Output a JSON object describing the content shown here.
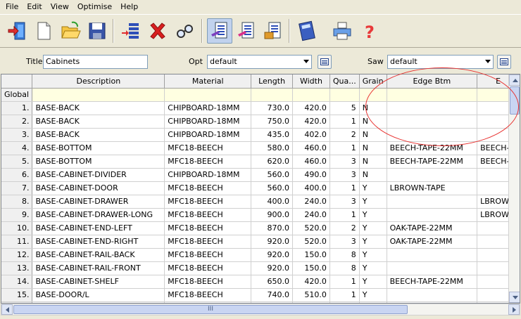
{
  "menu": [
    "File",
    "Edit",
    "View",
    "Optimise",
    "Help"
  ],
  "toolbar": {
    "buttons": [
      "exit-icon",
      "new-icon",
      "open-icon",
      "save-icon",
      "insert-row-icon",
      "delete-row-icon",
      "find-icon",
      "parts-list-icon",
      "edging-list-icon",
      "board-list-icon",
      "calculator-icon",
      "print-icon",
      "help-icon"
    ]
  },
  "params": {
    "title_label": "Title",
    "title_value": "Cabinets",
    "opt_label": "Opt",
    "opt_value": "default",
    "saw_label": "Saw",
    "saw_value": "default"
  },
  "grid": {
    "columns": [
      "",
      "Description",
      "Material",
      "Length",
      "Width",
      "Qua...",
      "Grain",
      "Edge Btm",
      "E"
    ],
    "global_label": "Global",
    "rows": [
      {
        "n": "1.",
        "desc": "BASE-BACK",
        "mat": "CHIPBOARD-18MM",
        "len": "730.0",
        "wid": "420.0",
        "qty": "5",
        "grain": "N",
        "edge": "",
        "e2": ""
      },
      {
        "n": "2.",
        "desc": "BASE-BACK",
        "mat": "CHIPBOARD-18MM",
        "len": "750.0",
        "wid": "420.0",
        "qty": "1",
        "grain": "N",
        "edge": "",
        "e2": ""
      },
      {
        "n": "3.",
        "desc": "BASE-BACK",
        "mat": "CHIPBOARD-18MM",
        "len": "435.0",
        "wid": "402.0",
        "qty": "2",
        "grain": "N",
        "edge": "",
        "e2": ""
      },
      {
        "n": "4.",
        "desc": "BASE-BOTTOM",
        "mat": "MFC18-BEECH",
        "len": "580.0",
        "wid": "460.0",
        "qty": "1",
        "grain": "N",
        "edge": "BEECH-TAPE-22MM",
        "e2": "BEECH-T"
      },
      {
        "n": "5.",
        "desc": "BASE-BOTTOM",
        "mat": "MFC18-BEECH",
        "len": "620.0",
        "wid": "460.0",
        "qty": "3",
        "grain": "N",
        "edge": "BEECH-TAPE-22MM",
        "e2": "BEECH-T"
      },
      {
        "n": "6.",
        "desc": "BASE-CABINET-DIVIDER",
        "mat": "CHIPBOARD-18MM",
        "len": "560.0",
        "wid": "490.0",
        "qty": "3",
        "grain": "N",
        "edge": "",
        "e2": ""
      },
      {
        "n": "7.",
        "desc": "BASE-CABINET-DOOR",
        "mat": "MFC18-BEECH",
        "len": "560.0",
        "wid": "400.0",
        "qty": "1",
        "grain": "Y",
        "edge": "LBROWN-TAPE",
        "e2": ""
      },
      {
        "n": "8.",
        "desc": "BASE-CABINET-DRAWER",
        "mat": "MFC18-BEECH",
        "len": "400.0",
        "wid": "240.0",
        "qty": "3",
        "grain": "Y",
        "edge": "",
        "e2": "LBROWN"
      },
      {
        "n": "9.",
        "desc": "BASE-CABINET-DRAWER-LONG",
        "mat": "MFC18-BEECH",
        "len": "900.0",
        "wid": "240.0",
        "qty": "1",
        "grain": "Y",
        "edge": "",
        "e2": "LBROWN"
      },
      {
        "n": "10.",
        "desc": "BASE-CABINET-END-LEFT",
        "mat": "MFC18-BEECH",
        "len": "870.0",
        "wid": "520.0",
        "qty": "2",
        "grain": "Y",
        "edge": "OAK-TAPE-22MM",
        "e2": ""
      },
      {
        "n": "11.",
        "desc": "BASE-CABINET-END-RIGHT",
        "mat": "MFC18-BEECH",
        "len": "920.0",
        "wid": "520.0",
        "qty": "3",
        "grain": "Y",
        "edge": "OAK-TAPE-22MM",
        "e2": ""
      },
      {
        "n": "12.",
        "desc": "BASE-CABINET-RAIL-BACK",
        "mat": "MFC18-BEECH",
        "len": "920.0",
        "wid": "150.0",
        "qty": "8",
        "grain": "Y",
        "edge": "",
        "e2": ""
      },
      {
        "n": "13.",
        "desc": "BASE-CABINET-RAIL-FRONT",
        "mat": "MFC18-BEECH",
        "len": "920.0",
        "wid": "150.0",
        "qty": "8",
        "grain": "Y",
        "edge": "",
        "e2": ""
      },
      {
        "n": "14.",
        "desc": "BASE-CABINET-SHELF",
        "mat": "MFC18-BEECH",
        "len": "650.0",
        "wid": "420.0",
        "qty": "1",
        "grain": "Y",
        "edge": "BEECH-TAPE-22MM",
        "e2": ""
      },
      {
        "n": "15.",
        "desc": "BASE-DOOR/L",
        "mat": "MFC18-BEECH",
        "len": "740.0",
        "wid": "510.0",
        "qty": "1",
        "grain": "Y",
        "edge": "",
        "e2": ""
      },
      {
        "n": "",
        "desc": "",
        "mat": "",
        "len": "",
        "wid": "",
        "qty": "",
        "grain": "",
        "edge": "",
        "e2": ""
      }
    ]
  },
  "hscroll_grip": "III",
  "colors": {
    "highlight_ellipse": "#e8312f",
    "global_row": "#ffffe1"
  }
}
